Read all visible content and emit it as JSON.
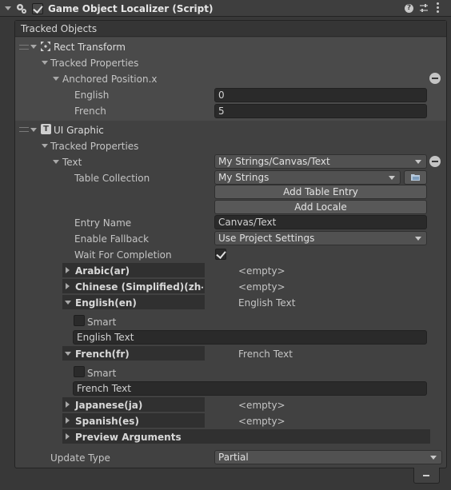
{
  "component": {
    "title": "Game Object Localizer (Script)",
    "enabled": true,
    "icons": [
      "help-icon",
      "presets-icon",
      "context-menu-icon"
    ]
  },
  "tracked_objects": {
    "header": "Tracked Objects",
    "rect_transform": {
      "name": "Rect Transform",
      "tracked_properties_label": "Tracked Properties",
      "property": {
        "name": "Anchored Position.x",
        "rows": [
          {
            "label": "English",
            "value": "0"
          },
          {
            "label": "French",
            "value": "5"
          }
        ]
      }
    },
    "ui_graphic": {
      "name": "UI Graphic",
      "tracked_properties_label": "Tracked Properties",
      "text_property": {
        "name": "Text",
        "selected": "My Strings/Canvas/Text",
        "table_collection_label": "Table Collection",
        "table_collection_value": "My Strings",
        "add_table_entry": "Add Table Entry",
        "add_locale": "Add Locale",
        "entry_name_label": "Entry Name",
        "entry_name_value": "Canvas/Text",
        "enable_fallback_label": "Enable Fallback",
        "enable_fallback_value": "Use Project Settings",
        "wait_for_completion_label": "Wait For Completion",
        "wait_for_completion": true,
        "locales": [
          {
            "name": "Arabic(ar)",
            "value": "<empty>",
            "expanded": false
          },
          {
            "name": "Chinese (Simplified)(zh-CN",
            "value": "<empty>",
            "expanded": false
          },
          {
            "name": "English(en)",
            "value": "English Text",
            "expanded": true,
            "smart_label": "Smart",
            "smart": false,
            "text": "English Text"
          },
          {
            "name": "French(fr)",
            "value": "French Text",
            "expanded": true,
            "smart_label": "Smart",
            "smart": false,
            "text": "French Text"
          },
          {
            "name": "Japanese(ja)",
            "value": "<empty>",
            "expanded": false
          },
          {
            "name": "Spanish(es)",
            "value": "<empty>",
            "expanded": false
          }
        ],
        "preview_arguments": "Preview Arguments"
      }
    }
  },
  "update_type": {
    "label": "Update Type",
    "value": "Partial"
  }
}
